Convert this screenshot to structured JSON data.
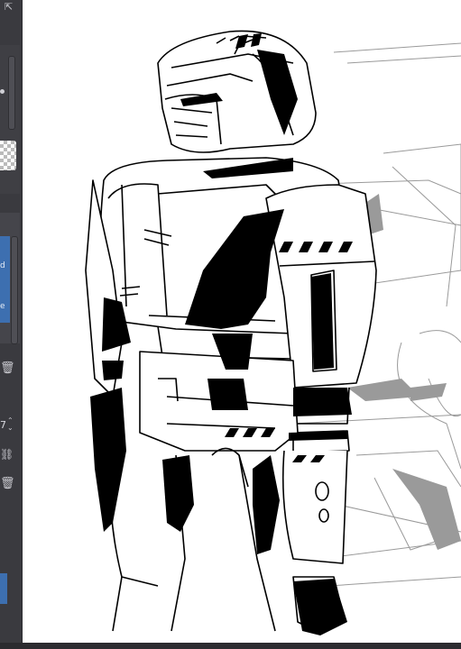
{
  "sidebar": {
    "panel_label_1": "d",
    "panel_label_2": "e",
    "opacity_value": "7"
  },
  "icons": {
    "collapse": "collapse-icon",
    "pin": "pin-icon",
    "transparency": "transparency-icon",
    "trash_1": "trash-icon",
    "trash_2": "trash-icon",
    "stepper": "stepper-icon",
    "link": "link-icon"
  },
  "colors": {
    "panel_bg": "#3a3a3f",
    "selected_layer": "#3d6fb0",
    "canvas_bg": "#ffffff",
    "ink": "#000000",
    "sketch": "#9a9a9a"
  }
}
